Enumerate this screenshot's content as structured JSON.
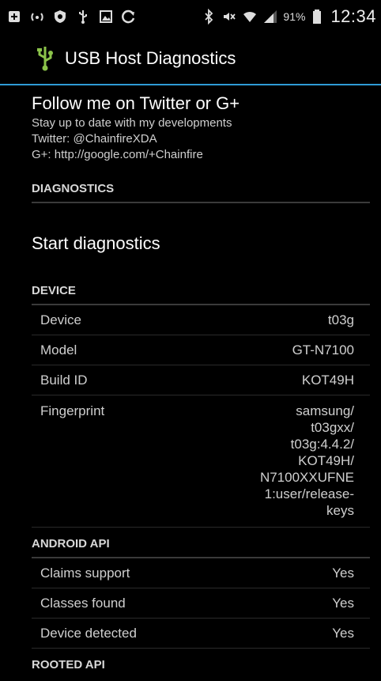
{
  "status_bar": {
    "icons": [
      "plus-square-icon",
      "wifi-hotspot-icon",
      "shield-icon",
      "usb-icon",
      "image-icon",
      "refresh-icon",
      "bluetooth-icon",
      "mute-icon",
      "wifi-icon",
      "signal-icon"
    ],
    "battery": "91%",
    "time": "12:34"
  },
  "action_bar": {
    "title": "USB Host Diagnostics"
  },
  "follow": {
    "title": "Follow me on Twitter or G+",
    "line1": "Stay up to date with my developments",
    "line2": "Twitter: @ChainfireXDA",
    "line3": "G+: http://google.com/+Chainfire"
  },
  "sections": {
    "diagnostics": "DIAGNOSTICS",
    "start_label": "Start diagnostics",
    "device": "DEVICE",
    "android_api": "ANDROID API",
    "rooted_api": "ROOTED API"
  },
  "device": [
    {
      "label": "Device",
      "value": "t03g"
    },
    {
      "label": "Model",
      "value": "GT-N7100"
    },
    {
      "label": "Build ID",
      "value": "KOT49H"
    },
    {
      "label": "Fingerprint",
      "value": [
        "samsung/",
        "t03gxx/",
        "t03g:4.4.2/",
        "KOT49H/",
        "N7100XXUFNE",
        "1:user/release-",
        "keys"
      ]
    }
  ],
  "android_api": [
    {
      "label": "Claims support",
      "value": "Yes"
    },
    {
      "label": "Classes found",
      "value": "Yes"
    },
    {
      "label": "Device detected",
      "value": "Yes"
    }
  ],
  "colors": {
    "accent": "#2f9bd6",
    "app_icon": "#8bc34a"
  }
}
